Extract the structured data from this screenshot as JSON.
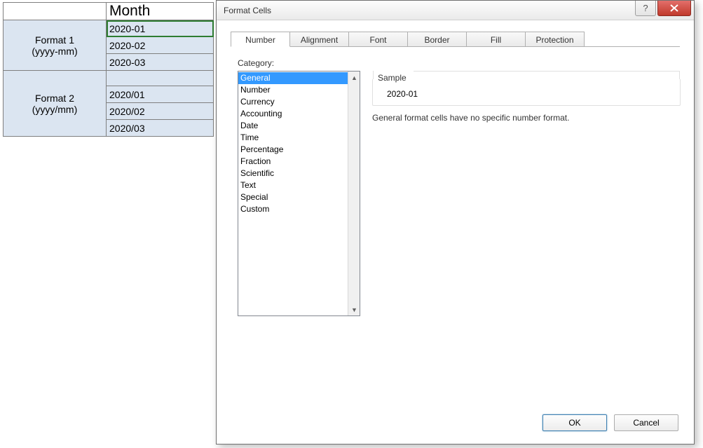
{
  "sheet": {
    "header_blank": "",
    "header_month": "Month",
    "format1_l1": "Format 1",
    "format1_l2": "(yyyy-mm)",
    "format1_vals": [
      "2020-01",
      "2020-02",
      "2020-03"
    ],
    "format2_l1": "Format 2",
    "format2_l2": "(yyyy/mm)",
    "format2_vals": [
      "2020/01",
      "2020/02",
      "2020/03"
    ]
  },
  "dialog": {
    "title": "Format Cells",
    "tabs": [
      "Number",
      "Alignment",
      "Font",
      "Border",
      "Fill",
      "Protection"
    ],
    "active_tab": "Number",
    "category_label": "Category:",
    "categories": [
      "General",
      "Number",
      "Currency",
      "Accounting",
      "Date",
      "Time",
      "Percentage",
      "Fraction",
      "Scientific",
      "Text",
      "Special",
      "Custom"
    ],
    "selected_category": "General",
    "sample_label": "Sample",
    "sample_value": "2020-01",
    "description": "General format cells have no specific number format.",
    "ok": "OK",
    "cancel": "Cancel"
  }
}
